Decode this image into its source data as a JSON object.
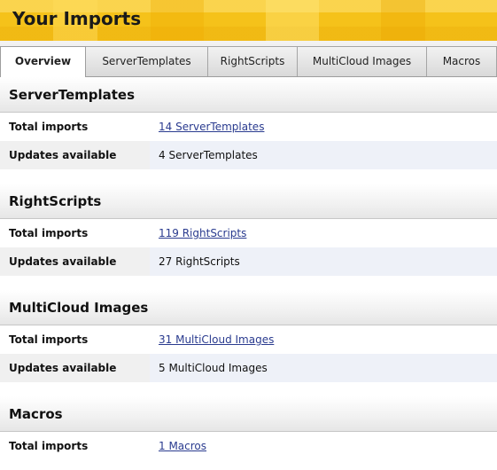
{
  "page": {
    "title": "Your Imports"
  },
  "tabs": [
    {
      "label": "Overview",
      "active": true
    },
    {
      "label": "ServerTemplates",
      "active": false
    },
    {
      "label": "RightScripts",
      "active": false
    },
    {
      "label": "MultiCloud Images",
      "active": false
    },
    {
      "label": "Macros",
      "active": false
    }
  ],
  "sections": [
    {
      "title": "ServerTemplates",
      "total_label": "Total imports",
      "total_value": "14 ServerTemplates",
      "updates_label": "Updates available",
      "updates_value": "4 ServerTemplates"
    },
    {
      "title": "RightScripts",
      "total_label": "Total imports",
      "total_value": "119 RightScripts",
      "updates_label": "Updates available",
      "updates_value": "27 RightScripts"
    },
    {
      "title": "MultiCloud Images",
      "total_label": "Total imports",
      "total_value": "31 MultiCloud Images",
      "updates_label": "Updates available",
      "updates_value": "5 MultiCloud Images"
    },
    {
      "title": "Macros",
      "total_label": "Total imports",
      "total_value": "1 Macros"
    }
  ],
  "colors": {
    "header_yellow": "#f5c21a",
    "link": "#2a3b8f",
    "alt_row": "#eef1f8"
  }
}
